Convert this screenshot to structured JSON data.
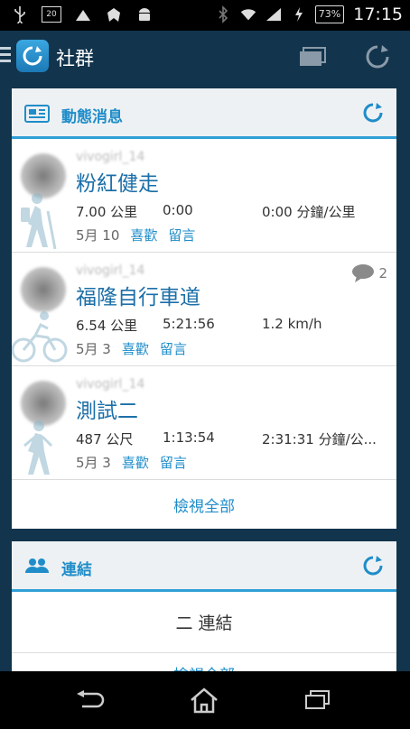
{
  "status_bar": {
    "notif_badge": "20",
    "battery": "73%",
    "time": "17:15",
    "icons": [
      "usb-icon",
      "calendar-icon",
      "upload-icon",
      "bug-icon",
      "android-icon",
      "bluetooth-icon",
      "wifi-icon",
      "signal-icon",
      "charging-icon",
      "battery-icon"
    ]
  },
  "app_bar": {
    "title": "社群",
    "icons": [
      "menu-icon",
      "app-logo-icon",
      "windows-icon",
      "refresh-icon"
    ]
  },
  "news_card": {
    "title": "動態消息",
    "items": [
      {
        "username": "vivogirl_14",
        "title": "粉紅健走",
        "distance": "7.00 公里",
        "duration": "0:00",
        "pace": "0:00 分鐘/公里",
        "date": "5月 10",
        "like": "喜歡",
        "comment": "留言",
        "sport": "hiking-icon"
      },
      {
        "username": "vivogirl_14",
        "title": "福隆自行車道",
        "distance": "6.54 公里",
        "duration": "5:21:56",
        "pace": "1.2 km/h",
        "date": "5月 3",
        "like": "喜歡",
        "comment": "留言",
        "comment_count": "2",
        "sport": "cycling-icon"
      },
      {
        "username": "vivogirl_14",
        "title": "測試二",
        "distance": "487 公尺",
        "duration": "1:13:54",
        "pace": "2:31:31 分鐘/公...",
        "date": "5月 3",
        "like": "喜歡",
        "comment": "留言",
        "sport": "walking-icon"
      }
    ],
    "view_all": "檢視全部"
  },
  "connections_card": {
    "title": "連結",
    "body": "二 連結",
    "partial": "檢視全部"
  },
  "colors": {
    "accent": "#1f8dc9",
    "app_bg": "#12344d"
  }
}
